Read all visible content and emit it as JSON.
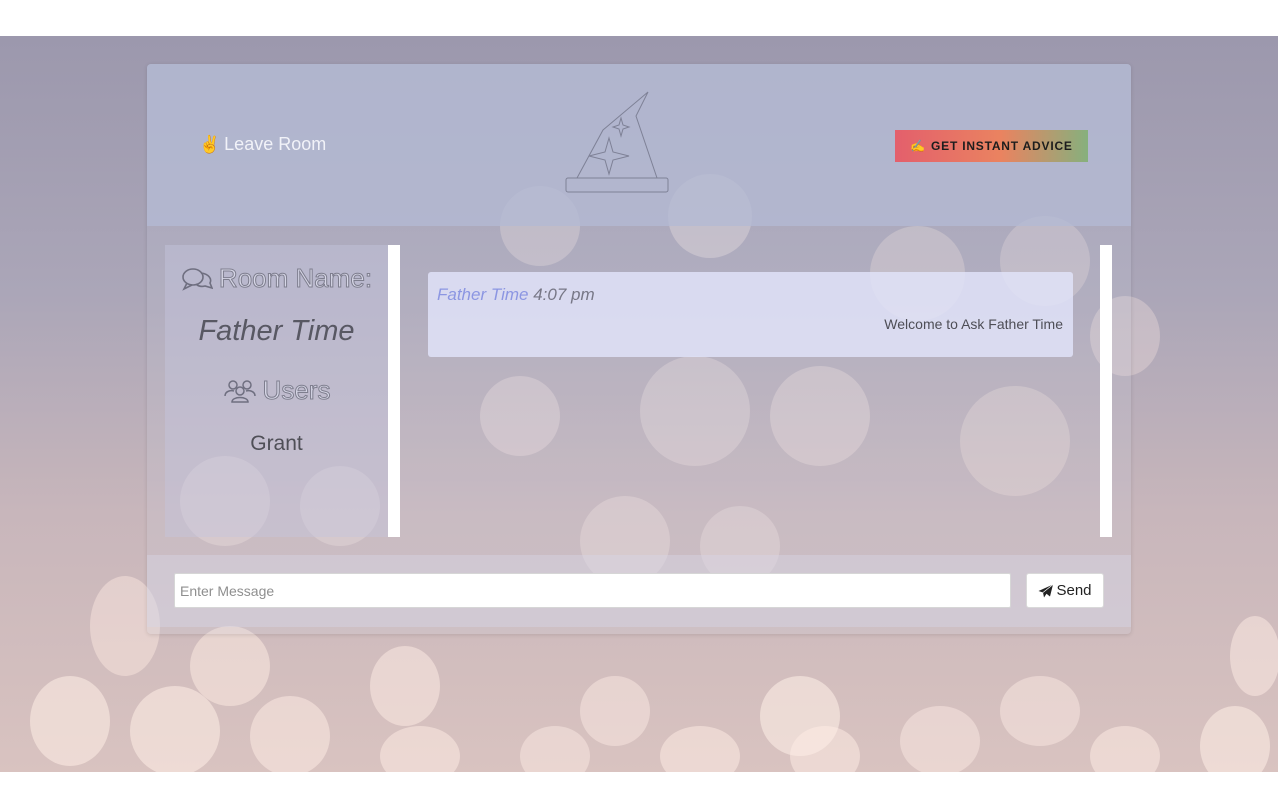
{
  "header": {
    "leave_label": "Leave Room",
    "advice_label": "GET INSTANT ADVICE"
  },
  "sidebar": {
    "room_label": "Room Name:",
    "room_name": "Father Time",
    "users_label": "Users",
    "users": [
      "Grant"
    ]
  },
  "chat": {
    "messages": [
      {
        "author": "Father Time",
        "time": "4:07 pm",
        "text": "Welcome to Ask Father Time"
      }
    ]
  },
  "composer": {
    "placeholder": "Enter Message",
    "value": "",
    "send_label": "Send"
  },
  "icons": {
    "leave": "peace-hand-icon",
    "advice": "magic-wand-icon",
    "room": "comments-icon",
    "users": "users-icon",
    "send": "paper-plane-icon",
    "logo": "wizard-hat-icon"
  },
  "colors": {
    "advice_gradient": [
      "#e35f6c",
      "#ea8360",
      "#86b07d"
    ],
    "author": "#8c96e2"
  }
}
